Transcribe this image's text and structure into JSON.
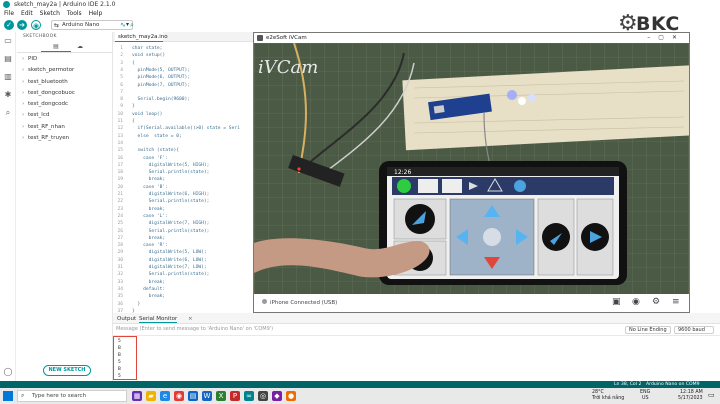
{
  "window": {
    "title": "sketch_may2a | Arduino IDE 2.1.0"
  },
  "menu": [
    "File",
    "Edit",
    "Sketch",
    "Tools",
    "Help"
  ],
  "toolbar": {
    "board": "Arduino Nano"
  },
  "logo": {
    "text": "BKC"
  },
  "sketchbook": {
    "title": "SKETCHBOOK",
    "items": [
      "PID",
      "sketch_permotor",
      "test_bluetooth",
      "test_dongcobuoc",
      "test_dongcodc",
      "test_lcd",
      "test_RF_nhan",
      "test_RF_truyen"
    ],
    "new_button": "NEW SKETCH"
  },
  "editor": {
    "tab": "sketch_may2a.ino",
    "lines": [
      "char state;",
      "void setup()",
      "{",
      "  pinMode(5, OUTPUT);",
      "  pinMode(6, OUTPUT);",
      "  pinMode(7, OUTPUT);",
      "",
      "  Serial.begin(9600);",
      "}",
      "void loop()",
      "{",
      "  if(Serial.available()>0) state = Seri",
      "  else  state = 0;",
      "",
      "  switch (state){",
      "    case 'F':",
      "      digitalWrite(5, HIGH);",
      "      Serial.println(state);",
      "      break;",
      "    case 'B':",
      "      digitalWrite(6, HIGH);",
      "      Serial.println(state);",
      "      break;",
      "    case 'L':",
      "      digitalWrite(7, HIGH);",
      "      Serial.println(state);",
      "      break;",
      "    case 'R':",
      "      digitalWrite(5, LOW);",
      "      digitalWrite(6, LOW);",
      "      digitalWrite(7, LOW);",
      "      Serial.println(state);",
      "      break;",
      "    default:",
      "      break;",
      "  }",
      "}"
    ]
  },
  "camera": {
    "title": "e2eSoft iVCam",
    "overlay": "iVCam",
    "status": "iPhone Connected (USB)",
    "phone_time": "12:26"
  },
  "output": {
    "tabs": [
      "Output",
      "Serial Monitor"
    ],
    "placeholder": "Message (Enter to send message to 'Arduino Nano' on 'COM9')",
    "line_ending": "No Line Ending",
    "baud": "9600 baud",
    "lines": [
      "5",
      "B",
      "B",
      "5",
      "B",
      "5"
    ]
  },
  "statusbar": {
    "position": "Ln 38, Col 2",
    "board": "Arduino Nano on COM9"
  },
  "taskbar": {
    "search_placeholder": "Type here to search",
    "weather": "28°C",
    "weather_desc": "Trời khá nắng",
    "lang": "ENG",
    "lang2": "US",
    "time": "12:18 AM",
    "date": "5/17/2023"
  },
  "colors": {
    "accent": "#00979c",
    "statusbar": "#006468",
    "highlight_box": "#e0463a"
  }
}
